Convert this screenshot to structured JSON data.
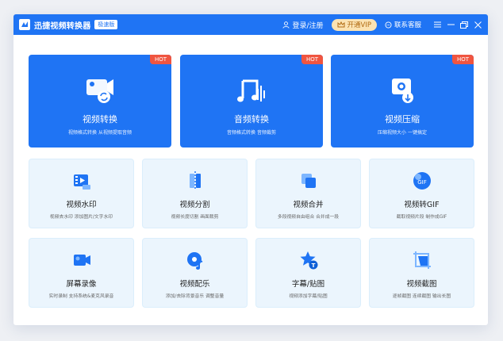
{
  "app": {
    "title": "迅捷视频转换器",
    "edition_badge": "极速版",
    "login_label": "登录/注册",
    "vip_label": "开通VIP",
    "support_label": "联系客服"
  },
  "featured": [
    {
      "title": "视频转换",
      "desc": "视频格式转换 从视频提取音频",
      "hot": "HOT",
      "icon": "video-convert-icon"
    },
    {
      "title": "音频转换",
      "desc": "音频格式转换 音频裁剪",
      "hot": "HOT",
      "icon": "audio-convert-icon"
    },
    {
      "title": "视频压缩",
      "desc": "压缩视频大小 一键搞定",
      "hot": "HOT",
      "icon": "video-compress-icon"
    }
  ],
  "tools": [
    {
      "title": "视频水印",
      "desc": "视频去水印 添加图片/文字水印",
      "icon": "watermark-icon"
    },
    {
      "title": "视频分割",
      "desc": "视频长度切割 画面裁剪",
      "icon": "split-icon"
    },
    {
      "title": "视频合并",
      "desc": "多段视频自由组合 合并成一段",
      "icon": "merge-icon"
    },
    {
      "title": "视频转GIF",
      "desc": "截取视频片段 制作成GIF",
      "icon": "gif-icon"
    },
    {
      "title": "屏幕录像",
      "desc": "实时录制 支持系统&麦克风录音",
      "icon": "screen-record-icon"
    },
    {
      "title": "视频配乐",
      "desc": "添加/去除背景音乐 调整音量",
      "icon": "music-icon"
    },
    {
      "title": "字幕/贴图",
      "desc": "视频添加字幕/贴图",
      "icon": "subtitle-icon"
    },
    {
      "title": "视频截图",
      "desc": "逐帧截图 连续截图 输出长图",
      "icon": "screenshot-icon"
    }
  ],
  "colors": {
    "primary": "#1f74f4",
    "hot": "#f05540",
    "tile_bg": "#ebf5fd",
    "vip_bg": "#fbe3b3"
  }
}
